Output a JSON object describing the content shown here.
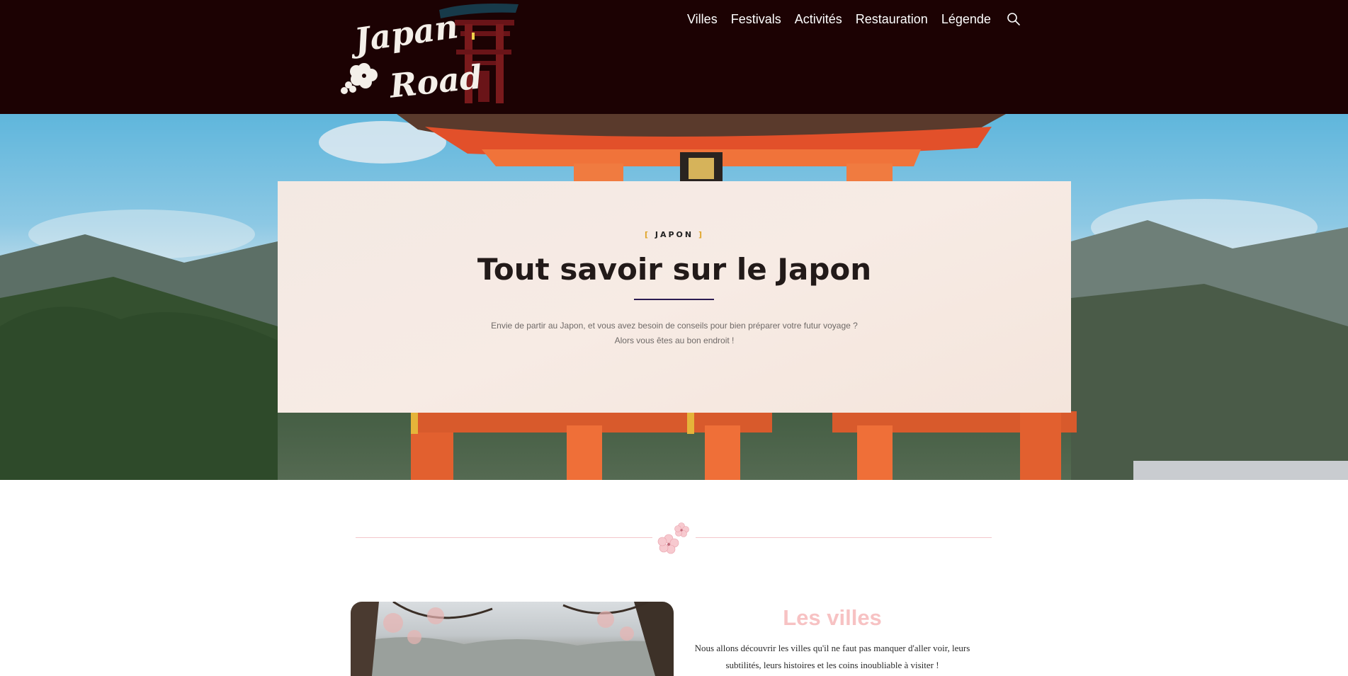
{
  "header": {
    "logo": {
      "line1": "Japan",
      "line2": "Road"
    },
    "nav": [
      {
        "label": "Villes"
      },
      {
        "label": "Festivals"
      },
      {
        "label": "Activités"
      },
      {
        "label": "Restauration"
      },
      {
        "label": "Légende"
      }
    ],
    "search_icon": "search-icon"
  },
  "hero": {
    "eyebrow_open": "[",
    "eyebrow": "JAPON",
    "eyebrow_close": "]",
    "title": "Tout savoir sur le Japon",
    "desc_line1": "Envie de partir au Japon, et vous avez besoin de conseils pour bien préparer votre futur voyage ?",
    "desc_line2": "Alors vous êtes au bon endroit !"
  },
  "villes": {
    "title": "Les villes",
    "desc": "Nous allons découvrir les villes qu'il ne faut pas manquer d'aller voir, leurs subtilités, leurs histoires et les coins inoubliable à visiter !"
  },
  "colors": {
    "header_bg": "#1c0203",
    "accent_pink": "#f7c2c3",
    "rule_purple": "#2b1c52",
    "eyebrow_bracket": "#e0a52a"
  }
}
